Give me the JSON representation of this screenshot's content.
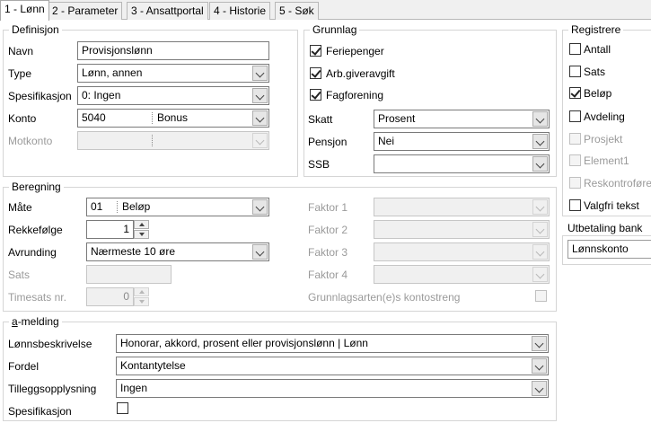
{
  "tabs": [
    "1 - Lønn",
    "2 - Parameter",
    "3 - Ansattportal",
    "4 - Historie",
    "5 - Søk"
  ],
  "definisjon": {
    "title": "Definisjon",
    "navn_label": "Navn",
    "navn_value": "Provisjonslønn",
    "type_label": "Type",
    "type_value": "Lønn, annen",
    "spes_label": "Spesifikasjon",
    "spes_value": "0: Ingen",
    "konto_label": "Konto",
    "konto_code": "5040",
    "konto_name": "Bonus",
    "motkonto_label": "Motkonto"
  },
  "grunnlag": {
    "title": "Grunnlag",
    "checks": [
      {
        "label": "Feriepenger",
        "checked": true
      },
      {
        "label": "Arb.giveravgift",
        "checked": true
      },
      {
        "label": "Fagforening",
        "checked": true
      }
    ],
    "skatt_label": "Skatt",
    "skatt_value": "Prosent",
    "pensjon_label": "Pensjon",
    "pensjon_value": "Nei",
    "ssb_label": "SSB",
    "ssb_value": ""
  },
  "registrere": {
    "title": "Registrere",
    "items": [
      {
        "label": "Antall",
        "checked": false,
        "enabled": true
      },
      {
        "label": "Sats",
        "checked": false,
        "enabled": true
      },
      {
        "label": "Beløp",
        "checked": true,
        "enabled": true
      },
      {
        "label": "Avdeling",
        "checked": false,
        "enabled": true
      },
      {
        "label": "Prosjekt",
        "checked": false,
        "enabled": false
      },
      {
        "label": "Element1",
        "checked": false,
        "enabled": false
      },
      {
        "label": "Reskontroføre",
        "checked": false,
        "enabled": false
      },
      {
        "label": "Valgfri tekst",
        "checked": false,
        "enabled": true
      }
    ]
  },
  "utbetaling": {
    "title": "Utbetaling bank",
    "value": "Lønnskonto"
  },
  "beregning": {
    "title": "Beregning",
    "maate_label": "Måte",
    "maate_code": "01",
    "maate_name": "Beløp",
    "rekke_label": "Rekkefølge",
    "rekke_value": "1",
    "avrunding_label": "Avrunding",
    "avrunding_value": "Nærmeste 10 øre",
    "sats_label": "Sats",
    "timesats_label": "Timesats nr.",
    "timesats_value": "0",
    "faktor": [
      "Faktor 1",
      "Faktor 2",
      "Faktor 3",
      "Faktor 4"
    ],
    "grunnlagsart_label": "Grunnlagsarten(e)s kontostreng"
  },
  "amelding": {
    "title": "a-melding",
    "lonnsbeskrivelse_label": "Lønnsbeskrivelse",
    "lonnsbeskrivelse_value": "Honorar, akkord, prosent eller provisjonslønn | Lønn",
    "fordel_label": "Fordel",
    "fordel_value": "Kontantytelse",
    "tillegg_label": "Tilleggsopplysning",
    "tillegg_value": "Ingen",
    "spes_label": "Spesifikasjon"
  }
}
